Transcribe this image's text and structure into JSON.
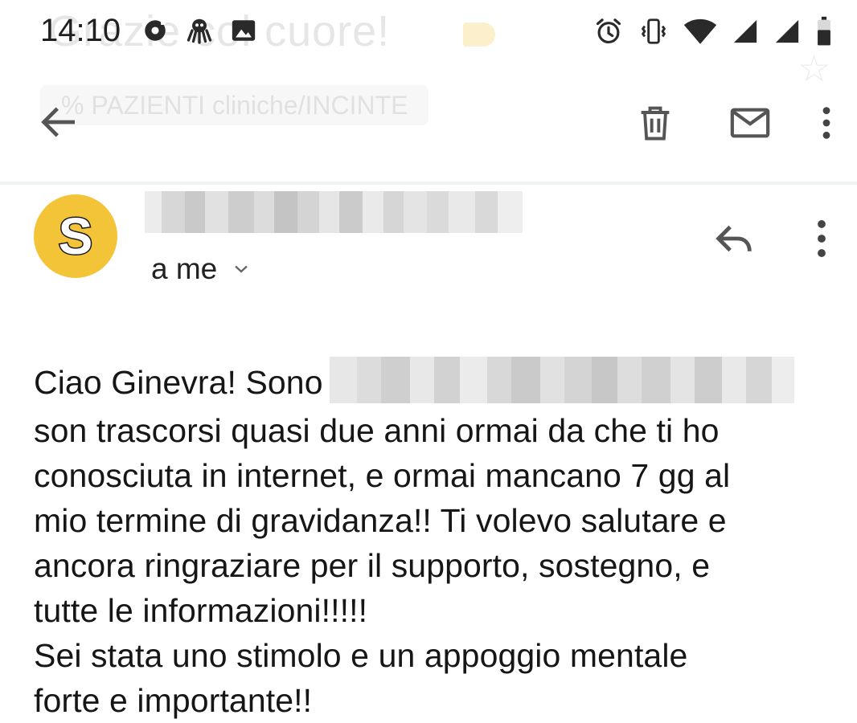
{
  "status_bar": {
    "time": "14:10",
    "icons_left": [
      "sync-icon",
      "octopus-icon",
      "image-icon"
    ],
    "icons_right": [
      "alarm-icon",
      "vibrate-icon",
      "wifi-icon",
      "signal-icon",
      "signal-icon",
      "battery-icon"
    ]
  },
  "background_ghost": {
    "subject": "Grazie col cuore!",
    "label": "% PAZIENTI cliniche/INCINTE"
  },
  "toolbar": {
    "back_icon": "arrow-back-icon",
    "delete_icon": "trash-icon",
    "mark_unread_icon": "mail-icon",
    "more_icon": "more-vert-icon"
  },
  "message": {
    "avatar_letter": "S",
    "avatar_color": "#f3c437",
    "recipients": "a me",
    "body_lines": [
      "Ciao Ginevra! Sono",
      "son trascorsi quasi due anni ormai da che ti ho",
      "conosciuta in internet, e ormai mancano 7 gg al",
      "mio termine di gravidanza!! Ti volevo salutare e",
      "ancora ringraziare per il supporto, sostegno, e",
      "tutte le informazioni!!!!!",
      "Sei stata uno stimolo e un appoggio mentale",
      "forte e importante!!"
    ]
  }
}
